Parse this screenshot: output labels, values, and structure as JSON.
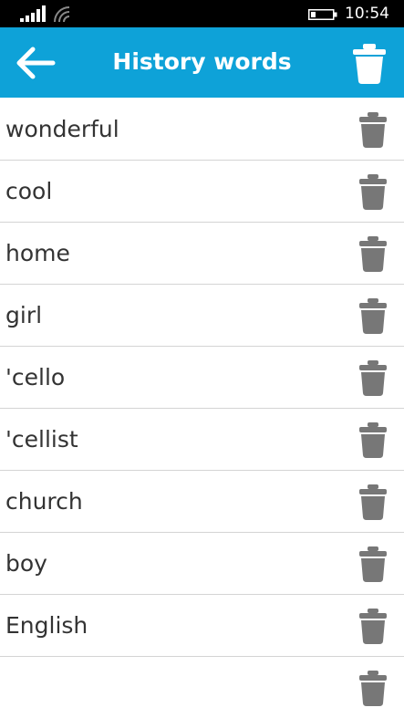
{
  "status": {
    "time": "10:54"
  },
  "header": {
    "title": "History words",
    "back_icon": "arrow-left-icon",
    "clear_icon": "trash-icon"
  },
  "colors": {
    "accent": "#0ea2d8",
    "icon_gray": "#777777"
  },
  "words": [
    "wonderful",
    "cool",
    "home",
    "girl",
    "'cello",
    "'cellist",
    "church",
    "boy",
    "English"
  ]
}
